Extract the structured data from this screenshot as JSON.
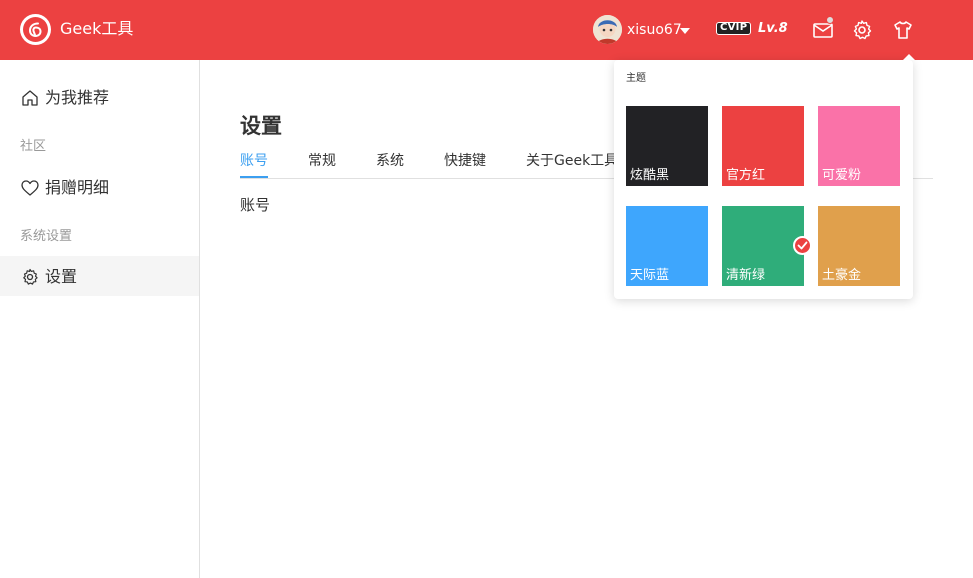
{
  "header": {
    "app_title": "Geek工具",
    "username": "xisuo67",
    "vip_label": "CVIP",
    "level": "Lv.8",
    "colors": {
      "bar": "#ec4141",
      "text": "#ffffff"
    },
    "icons": [
      "app-logo-icon",
      "avatar",
      "caret-down-icon",
      "mail-icon",
      "gear-icon",
      "tshirt-icon"
    ]
  },
  "sidebar": {
    "items": [
      {
        "label": "为我推荐",
        "icon": "home-icon"
      },
      {
        "label": "捐赠明细",
        "icon": "heart-icon"
      },
      {
        "label": "设置",
        "icon": "gear-icon"
      }
    ],
    "sections": [
      "社区",
      "系统设置"
    ]
  },
  "main": {
    "title": "设置",
    "tabs": [
      {
        "label": "账号",
        "active": true
      },
      {
        "label": "常规"
      },
      {
        "label": "系统"
      },
      {
        "label": "快捷键"
      },
      {
        "label": "关于Geek工具"
      }
    ],
    "content": "账号",
    "accent": "#3c9ff0"
  },
  "theme_popover": {
    "title": "主题",
    "themes": [
      {
        "name": "炫酷黑",
        "color": "#222225"
      },
      {
        "name": "官方红",
        "color": "#ec4141",
        "selected": true
      },
      {
        "name": "可爱粉",
        "color": "#fa72a8"
      },
      {
        "name": "天际蓝",
        "color": "#3ea6fd"
      },
      {
        "name": "清新绿",
        "color": "#2fad7a"
      },
      {
        "name": "土豪金",
        "color": "#e0a04c"
      }
    ]
  }
}
